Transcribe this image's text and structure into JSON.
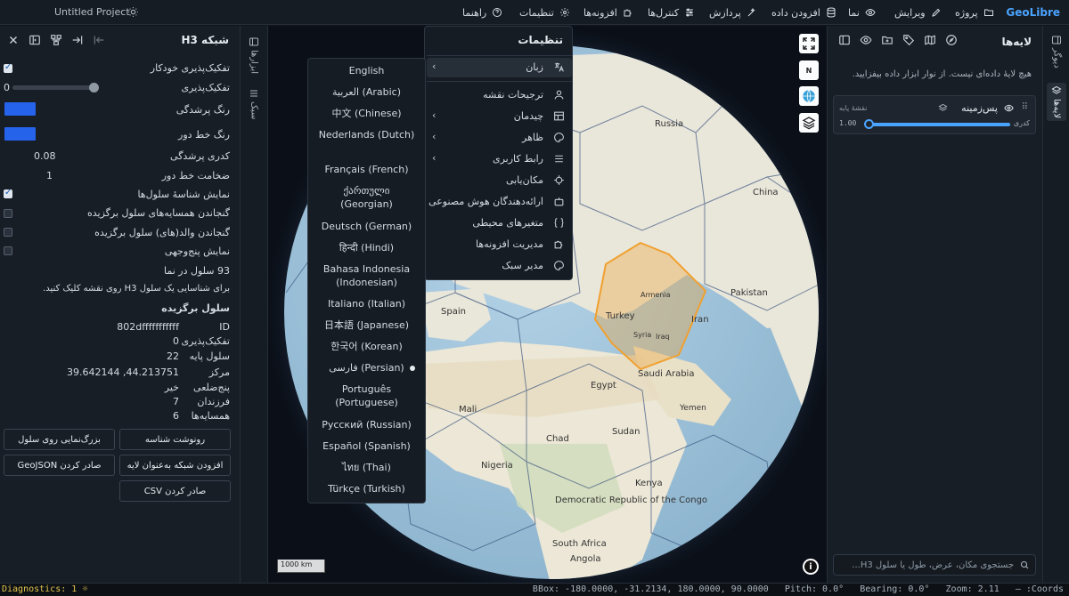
{
  "app": {
    "brand": "GeoLibre",
    "project_name": "Untitled Project"
  },
  "topbar": {
    "menu": [
      "پروژه",
      "ویرایش",
      "نما",
      "افزودن داده",
      "پردازش",
      "کنترل‌ها",
      "افزونه‌ها",
      "تنظیمات",
      "راهنما"
    ]
  },
  "left_panel": {
    "title": "شبکه H3",
    "auto_resolution_label": "تفکیک‌پذیری خودکار",
    "resolution_label": "تفکیک‌پذیری",
    "resolution_value": "0",
    "fill_color_label": "رنگ پرشدگی",
    "stroke_color_label": "رنگ خط دور",
    "fill_opacity_label": "کدری پرشدگی",
    "fill_opacity_value": "0.08",
    "stroke_width_label": "ضخامت خط دور",
    "stroke_width_value": "1",
    "show_ids_label": "نمایش شناسهٔ سلول‌ها",
    "include_neighbors_label": "گنجاندن همسایه‌های سلول برگزیده",
    "include_parents_label": "گنجاندن والد(های) سلول برگزیده",
    "show_pentagons_label": "نمایش پنج‌وجهی",
    "cells_in_view": "93 سلول در نما",
    "click_hint": "برای شناسایی یک سلول H3 روی نقشه کلیک کنید.",
    "selected_title": "سلول برگزیده",
    "selected": [
      {
        "key": "ID",
        "value": "802dfffffffffff"
      },
      {
        "key": "تفکیک‌پذیری",
        "value": "0"
      },
      {
        "key": "سلول پایه",
        "value": "22"
      },
      {
        "key": "مرکز",
        "value": "39.642144 ,44.213751"
      },
      {
        "key": "پنج‌ضلعی",
        "value": "خیر"
      },
      {
        "key": "فرزندان",
        "value": "7"
      },
      {
        "key": "همسایه‌ها",
        "value": "6"
      }
    ],
    "buttons": {
      "copy_id": "رونوشت شناسه",
      "zoom_cell": "بزرگ‌نمایی روی سلول",
      "add_grid_layer": "افزودن شبکه به‌عنوان لایه",
      "export_geojson": "صادر کردن GeoJSON",
      "export_csv": "صادر کردن CSV"
    }
  },
  "left_rail": {
    "tools_label": "ابزارها",
    "style_label": "سبک"
  },
  "settings_menu": {
    "title": "تنظیمات",
    "items": [
      {
        "label": "زبان",
        "icon": "translate-icon",
        "submenu": true
      },
      {
        "label": "ترجیحات نقشه",
        "icon": "user-pin-icon",
        "submenu": false
      },
      {
        "label": "چیدمان",
        "icon": "layout-icon",
        "submenu": true
      },
      {
        "label": "ظاهر",
        "icon": "palette-icon",
        "submenu": true
      },
      {
        "label": "رابط کاربری",
        "icon": "sliders-icon",
        "submenu": true
      },
      {
        "label": "مکان‌یابی",
        "icon": "crosshair-icon",
        "submenu": false
      },
      {
        "label": "ارائه‌دهندگان هوش مصنوعی",
        "icon": "robot-icon",
        "submenu": false
      },
      {
        "label": "متغیرهای محیطی",
        "icon": "braces-icon",
        "submenu": false
      },
      {
        "label": "مدیریت افزونه‌ها",
        "icon": "puzzle-icon",
        "submenu": false
      },
      {
        "label": "مدیر سبک",
        "icon": "palette-icon",
        "submenu": false
      }
    ]
  },
  "language_menu": {
    "selected": "فارسی (Persian)",
    "options": [
      "English",
      "العربية (Arabic)",
      "中文 (Chinese)",
      "Nederlands (Dutch)",
      "Français (French)",
      "ქართული (Georgian)",
      "Deutsch (German)",
      "हिन्दी (Hindi)",
      "Bahasa Indonesia (Indonesian)",
      "Italiano (Italian)",
      "日本語 (Japanese)",
      "한국어 (Korean)",
      "فارسی (Persian)",
      "Português (Portuguese)",
      "Русский (Russian)",
      "Español (Spanish)",
      "ไทย (Thai)",
      "Türkçe (Turkish)"
    ]
  },
  "map": {
    "scale_label": "1000 km",
    "compass_letter": "N",
    "place_labels": [
      {
        "text": "Spain"
      },
      {
        "text": "Turkey"
      },
      {
        "text": "Armenia"
      },
      {
        "text": "Iran"
      },
      {
        "text": "Syria"
      },
      {
        "text": "Iraq"
      },
      {
        "text": "Egypt"
      },
      {
        "text": "Saudi Arabia"
      },
      {
        "text": "Nigeria"
      },
      {
        "text": "Kenya"
      },
      {
        "text": "Democratic Republic of the Congo"
      },
      {
        "text": "South Africa"
      },
      {
        "text": "Yemen"
      },
      {
        "text": "Pakistan"
      },
      {
        "text": "Russia"
      },
      {
        "text": "China"
      },
      {
        "text": "Sudan"
      },
      {
        "text": "Chad"
      },
      {
        "text": "Mali"
      },
      {
        "text": "Angola"
      }
    ]
  },
  "layers_panel": {
    "title": "لایه‌ها",
    "empty_text": "هیچ لایهٔ داده‌ای نیست. از نوار ابزار داده بیفزایید.",
    "basemap": {
      "name": "پس‌زمینه",
      "badge": "نقشهٔ پایه",
      "opacity_label": "کدری",
      "opacity": "1.00",
      "opacity_fraction": 1.0
    },
    "search_placeholder": "جستجوی مکان، عرض، طول یا سلول H3..."
  },
  "right_rail": {
    "layers_label": "لایه‌ها",
    "network_label": "دیوگر"
  },
  "statusbar": {
    "diagnostics": "Diagnostics: 1",
    "bbox": "BBox: -180.0000, -31.2134, 180.0000, 90.0000",
    "pitch": "Pitch: 0.0°",
    "bearing": "Bearing: 0.0°",
    "zoom": "Zoom: 2.11",
    "coords": "— :Coords"
  },
  "colors": {
    "accent": "#4aa3ff",
    "fill_swatch": "#2563eb",
    "hex_highlight": "#f0a030"
  }
}
